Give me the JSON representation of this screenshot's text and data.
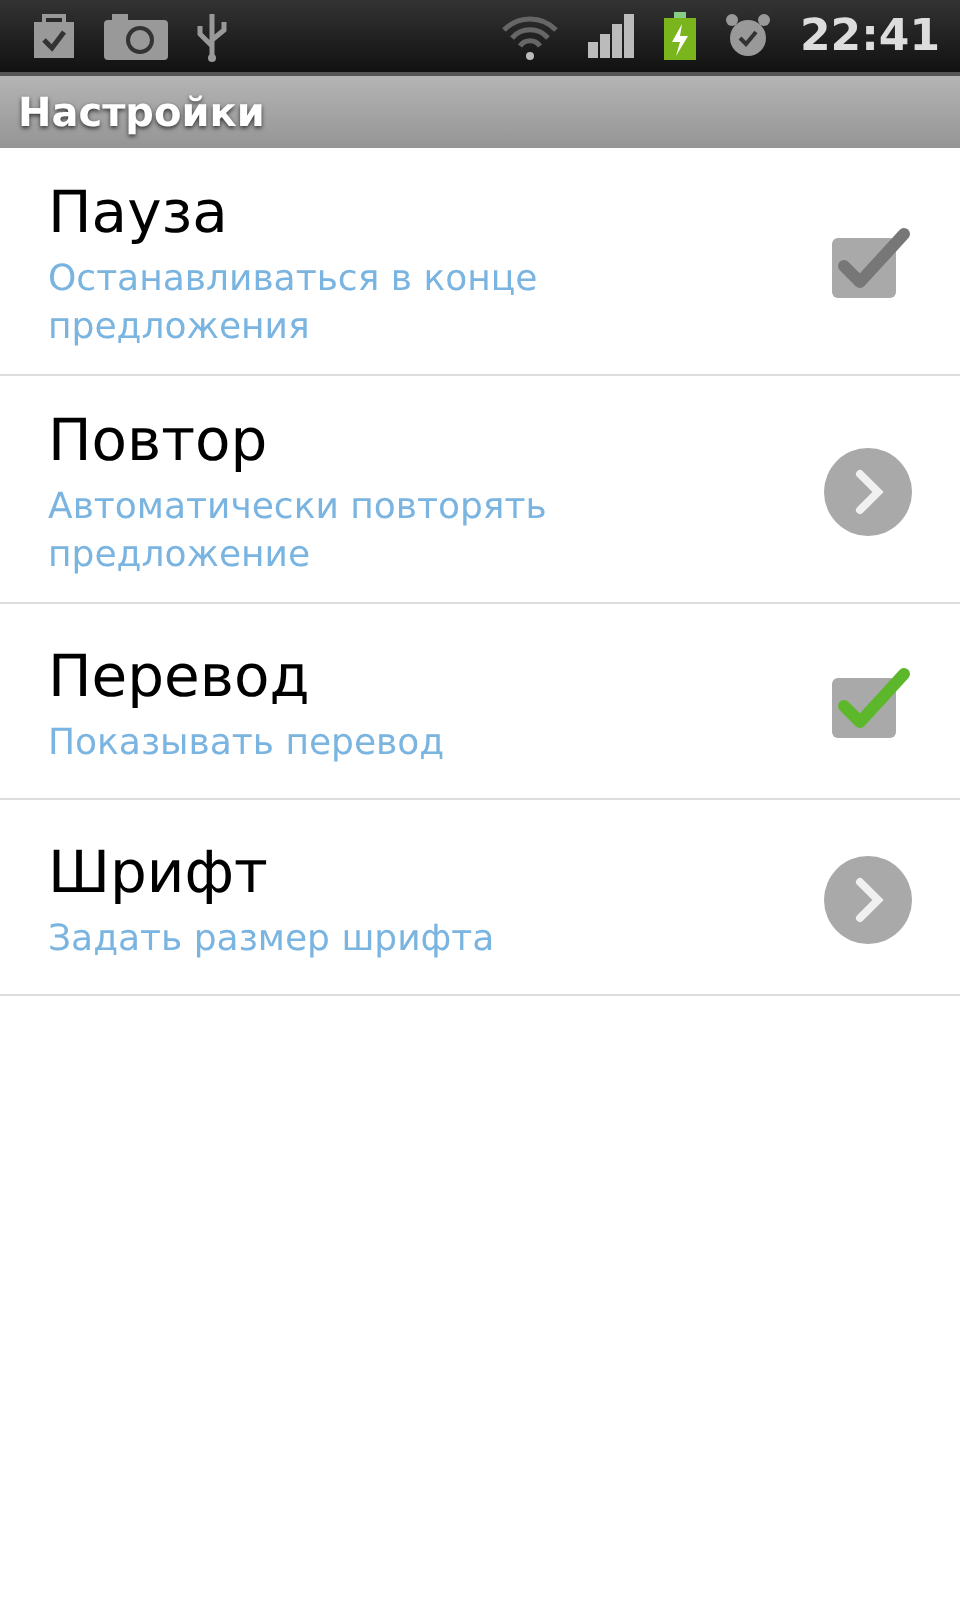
{
  "status_bar": {
    "time": "22:41"
  },
  "title": "Настройки",
  "items": [
    {
      "kind": "checkbox",
      "title": "Пауза",
      "summary": "Останавливаться в конце предложения",
      "checked": false
    },
    {
      "kind": "arrow",
      "title": "Повтор",
      "summary": "Автоматически повторять предложение"
    },
    {
      "kind": "checkbox",
      "title": "Перевод",
      "summary": "Показывать перевод",
      "checked": true
    },
    {
      "kind": "arrow",
      "title": "Шрифт",
      "summary": "Задать размер шрифта"
    }
  ]
}
